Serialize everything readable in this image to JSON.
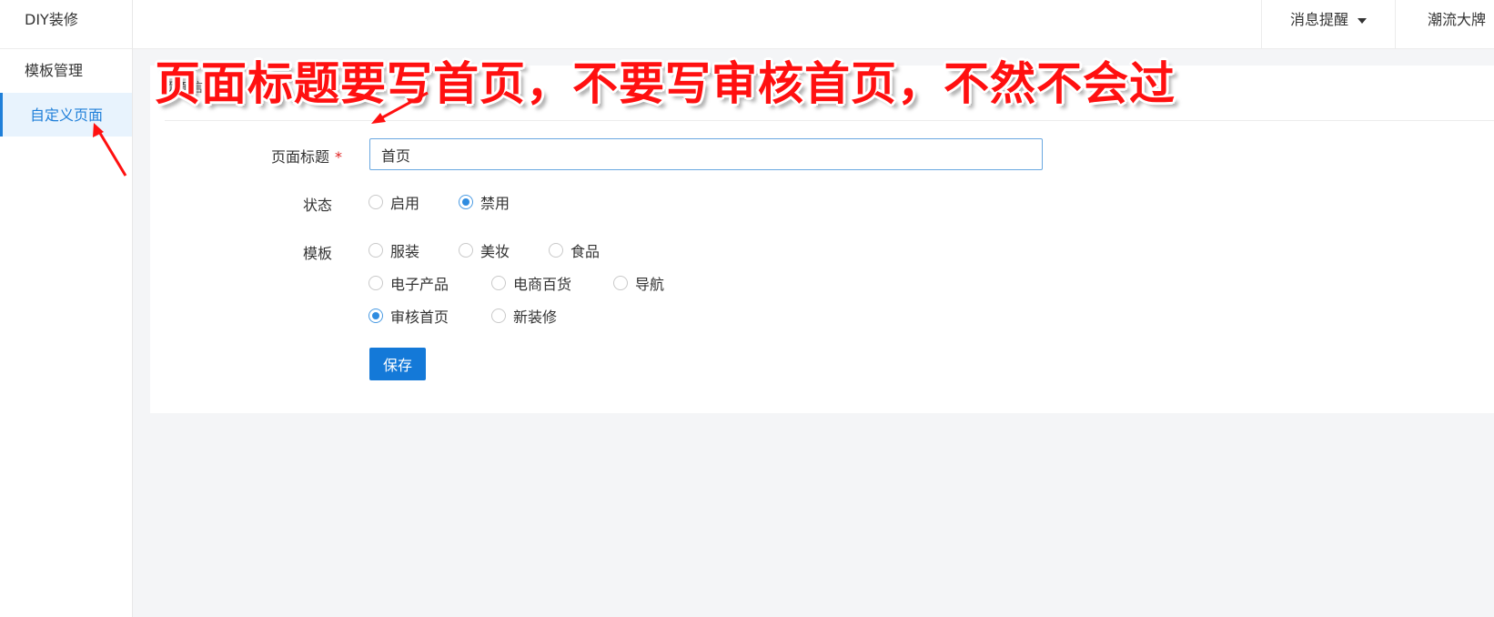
{
  "sidebar": {
    "brand": "DIY装修",
    "items": [
      {
        "label": "模板管理",
        "active": false
      },
      {
        "label": "自定义页面",
        "active": true
      }
    ]
  },
  "header": {
    "messages_label": "消息提醒",
    "user_label": "潮流大牌"
  },
  "panel": {
    "title": "页面信息"
  },
  "form": {
    "title_label": "页面标题",
    "required_mark": "*",
    "title_value": "首页",
    "status_label": "状态",
    "status_options": [
      {
        "label": "启用",
        "selected": false
      },
      {
        "label": "禁用",
        "selected": true
      }
    ],
    "template_label": "模板",
    "template_options": [
      {
        "label": "服装",
        "selected": false
      },
      {
        "label": "美妆",
        "selected": false
      },
      {
        "label": "食品",
        "selected": false
      },
      {
        "label": "电子产品",
        "selected": false
      },
      {
        "label": "电商百货",
        "selected": false
      },
      {
        "label": "导航",
        "selected": false
      },
      {
        "label": "审核首页",
        "selected": true
      },
      {
        "label": "新装修",
        "selected": false
      }
    ],
    "save_label": "保存"
  },
  "annotation": {
    "text": "页面标题要写首页，不要写审核首页，不然不会过",
    "color": "#ff1010"
  },
  "colors": {
    "accent": "#1479d8",
    "background": "#f4f5f7"
  }
}
